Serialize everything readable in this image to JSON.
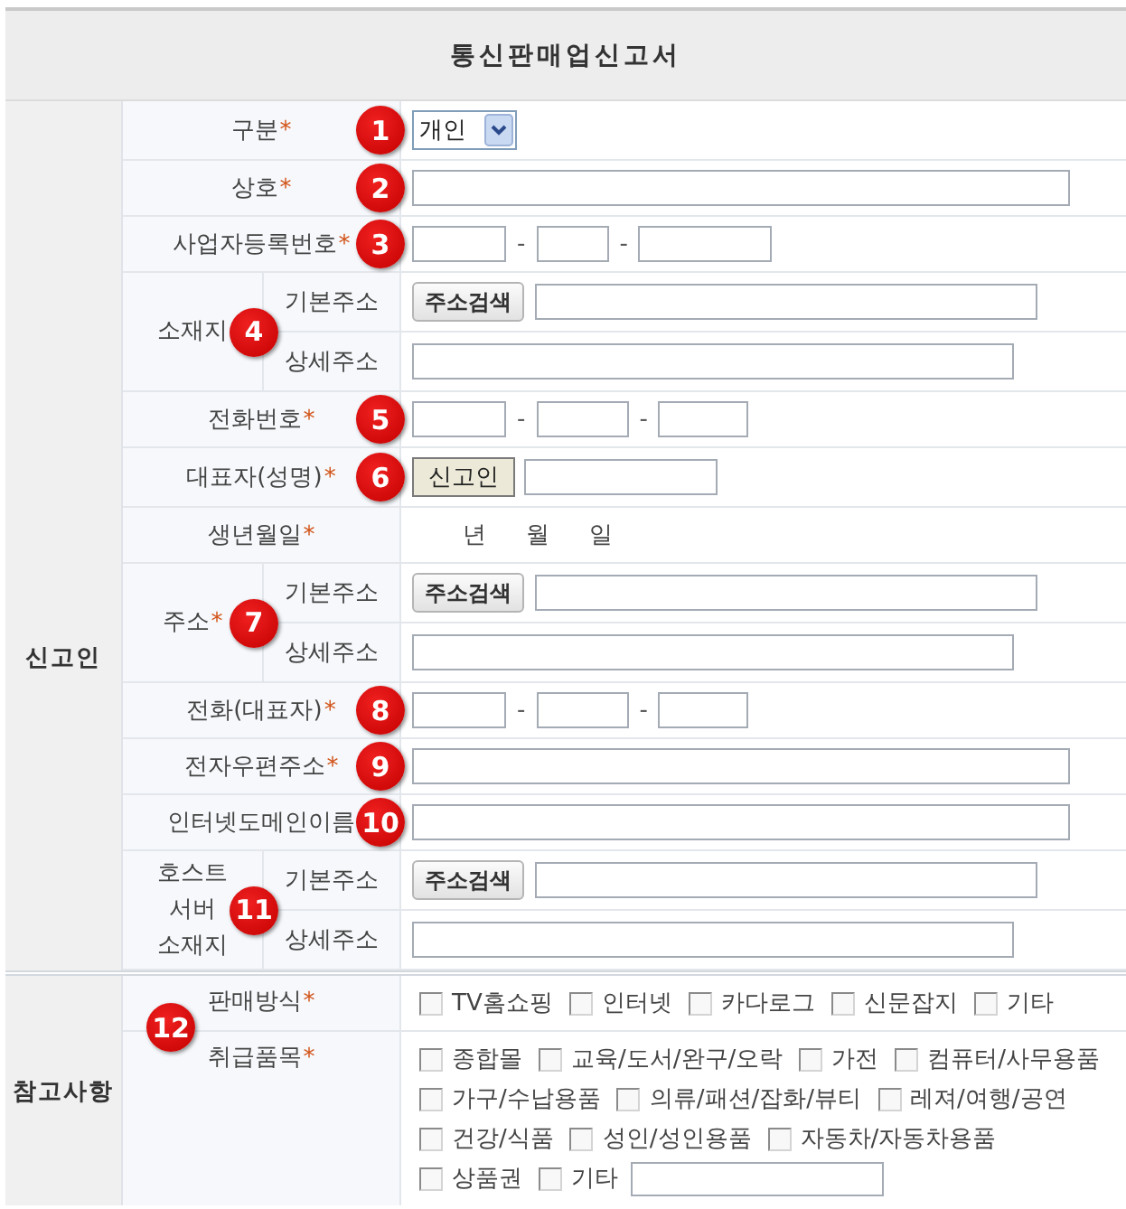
{
  "title": "통신판매업신고서",
  "sections": [
    {
      "label": "신고인",
      "rows": [
        {
          "kind": "select",
          "label": "구분",
          "mark": "*",
          "marker": "1",
          "value": "개인"
        },
        {
          "kind": "text",
          "label": "상호",
          "mark": "*",
          "marker": "2"
        },
        {
          "kind": "business_number",
          "label": "사업자등록번호",
          "mark": "*",
          "marker": "3",
          "separators": [
            "-",
            "-"
          ]
        },
        {
          "kind": "address",
          "label": "소재지",
          "marker": "4",
          "sub_rows": [
            {
              "label": "기본주소",
              "button": "주소검색"
            },
            {
              "label": "상세주소"
            }
          ]
        },
        {
          "kind": "phone",
          "label": "전화번호",
          "mark": "*",
          "marker": "5",
          "separators": [
            "-",
            "-"
          ]
        },
        {
          "kind": "person",
          "label": "대표자(성명)",
          "mark": "*",
          "marker": "6",
          "button": "신고인"
        },
        {
          "kind": "date",
          "label": "생년월일",
          "mark": "*",
          "units": [
            "년",
            "월",
            "일"
          ]
        },
        {
          "kind": "address",
          "label": "주소",
          "mark": "*",
          "marker": "7",
          "sub_rows": [
            {
              "label": "기본주소",
              "button": "주소검색"
            },
            {
              "label": "상세주소"
            }
          ]
        },
        {
          "kind": "phone",
          "label": "전화(대표자)",
          "mark": "*",
          "marker": "8",
          "separators": [
            "-",
            "-"
          ]
        },
        {
          "kind": "text",
          "label": "전자우편주소",
          "mark": "*",
          "marker": "9"
        },
        {
          "kind": "text",
          "label": "인터넷도메인이름",
          "marker": "10"
        },
        {
          "kind": "address",
          "label": "호스트 서버 소재지",
          "marker": "11",
          "sub_rows": [
            {
              "label": "기본주소",
              "button": "주소검색"
            },
            {
              "label": "상세주소"
            }
          ]
        }
      ]
    },
    {
      "label": "참고사항",
      "marker": "12",
      "rows": [
        {
          "kind": "checkboxes",
          "label": "판매방식",
          "mark": "*",
          "option_lines": [
            [
              {
                "label": "TV홈쇼핑",
                "checked": false
              },
              {
                "label": "인터넷",
                "checked": false
              },
              {
                "label": "카다로그",
                "checked": false
              },
              {
                "label": "신문잡지",
                "checked": false
              },
              {
                "label": "기타",
                "checked": false
              }
            ]
          ]
        },
        {
          "kind": "checkboxes",
          "label": "취급품목",
          "mark": "*",
          "trailing_field": true,
          "option_lines": [
            [
              {
                "label": "종합몰",
                "checked": false
              },
              {
                "label": "교육/도서/완구/오락",
                "checked": false
              },
              {
                "label": "가전",
                "checked": false
              },
              {
                "label": "컴퓨터/사무용품",
                "checked": false
              }
            ],
            [
              {
                "label": "가구/수납용품",
                "checked": false
              },
              {
                "label": "의류/패션/잡화/뷰티",
                "checked": false
              },
              {
                "label": "레져/여행/공연",
                "checked": false
              }
            ],
            [
              {
                "label": "건강/식품",
                "checked": false
              },
              {
                "label": "성인/성인용품",
                "checked": false
              },
              {
                "label": "자동차/자동차용품",
                "checked": false
              }
            ],
            [
              {
                "label": "상품권",
                "checked": false
              },
              {
                "label": "기타",
                "checked": false
              }
            ]
          ]
        }
      ]
    }
  ]
}
